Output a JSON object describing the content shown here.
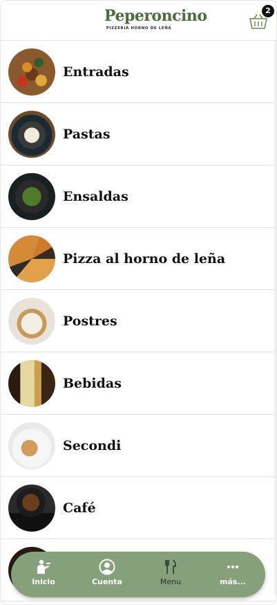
{
  "header": {
    "logo_title": "Peperoncino",
    "logo_subtitle": "PIZZERIA HORNO DE LEÑA",
    "cart_icon": "basket-icon",
    "cart_count": "2"
  },
  "categories": [
    {
      "label": "Entradas",
      "thumb": "entradas"
    },
    {
      "label": "Pastas",
      "thumb": "pastas"
    },
    {
      "label": "Ensaldas",
      "thumb": "ensaldas"
    },
    {
      "label": "Pizza al horno de leña",
      "thumb": "pizza"
    },
    {
      "label": "Postres",
      "thumb": "postres"
    },
    {
      "label": "Bebidas",
      "thumb": "bebidas"
    },
    {
      "label": "Secondi",
      "thumb": "secondi"
    },
    {
      "label": "Café",
      "thumb": "cafe"
    },
    {
      "label": "",
      "thumb": "extra"
    }
  ],
  "bottom_nav": {
    "items": [
      {
        "label": "Inicio",
        "icon": "waiter-icon"
      },
      {
        "label": "Cuenta",
        "icon": "user-icon"
      },
      {
        "label": "Menu",
        "icon": "cutlery-icon",
        "active": true
      },
      {
        "label": "más...",
        "icon": "more-icon"
      }
    ]
  },
  "colors": {
    "brand_green": "#4e6b3d",
    "nav_background": "#86a07c",
    "badge_background": "#111111"
  }
}
